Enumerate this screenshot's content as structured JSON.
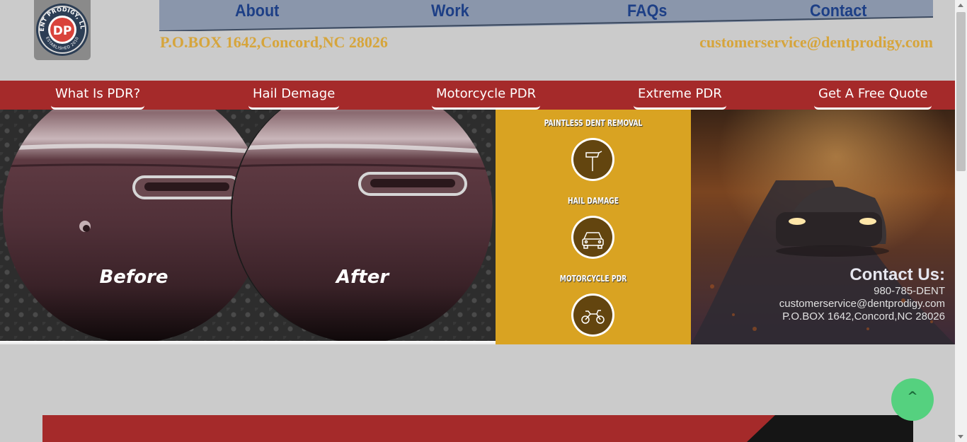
{
  "header": {
    "logo_alt": "DENT PRODIGY, LLC. ESTABLISHED 2010",
    "logo_top_text": "DENT PRODIGY, LLC.",
    "logo_initials": "DP",
    "logo_bottom_text": "ESTABLISHED 2010",
    "nav": [
      {
        "label": "About"
      },
      {
        "label": "Work"
      },
      {
        "label": "FAQs"
      },
      {
        "label": "Contact"
      }
    ],
    "address": "P.O.BOX 1642,Concord,NC 28026",
    "email": "customerservice@dentprodigy.com"
  },
  "subnav": [
    {
      "label": "What Is PDR?"
    },
    {
      "label": "Hail Demage"
    },
    {
      "label": "Motorcycle PDR"
    },
    {
      "label": "Extreme PDR"
    },
    {
      "label": "Get A Free Quote"
    }
  ],
  "banner": {
    "before_label": "Before",
    "after_label": "After",
    "services": [
      {
        "title": "PAINTLESS DENT REMOVAL",
        "icon": "hammer-icon"
      },
      {
        "title": "HAIL DAMAGE",
        "icon": "car-icon"
      },
      {
        "title": "MOTORCYCLE PDR",
        "icon": "motorcycle-icon"
      }
    ],
    "contact": {
      "heading": "Contact Us:",
      "phone": "980-785-DENT",
      "email": "customerservice@dentprodigy.com",
      "address": "P.O.BOX 1642,Concord,NC 28026"
    }
  },
  "back_to_top": "^",
  "colors": {
    "page_bg": "#cbcbcb",
    "nav_bar": "#8a96ab",
    "nav_text": "#1d3f86",
    "gold_text": "#d6a53c",
    "red_bar": "#a52a2a",
    "services_bg": "#d9a322",
    "back_to_top": "#55d17f"
  }
}
